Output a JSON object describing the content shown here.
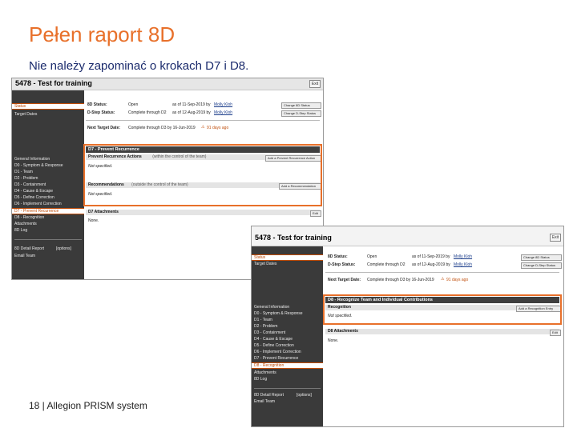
{
  "slide": {
    "title": "Pełen raport 8D",
    "subtitle": "Nie należy zapominać o krokach D7 i D8.",
    "footer": "18 | Allegion PRISM system"
  },
  "colors": {
    "accent": "#e8702a",
    "subtitle": "#1a2a6c",
    "sidebar": "#3a3a3a"
  },
  "shot1": {
    "title": "5478 - Test for training",
    "exit": "Exit",
    "sidebar": {
      "status": "Status",
      "target_dates": "Target Dates",
      "items": [
        "General Information",
        "D0 - Symptom & Response",
        "D1 - Team",
        "D2 - Problem",
        "D3 - Containment",
        "D4 - Cause & Escape",
        "D5 - Define Correction",
        "D6 - Implement Correction",
        "D7 - Prevent Recurrence",
        "D8 - Recognition",
        "Attachments",
        "8D Log"
      ],
      "highlighted_index": 8,
      "report": "8D Detail Report",
      "options": "[options]",
      "email": "Email Team"
    },
    "status": {
      "label_8d": "8D Status:",
      "value_8d": "Open",
      "asof_8d": "as of 11-Sep-2019 by",
      "user_8d": "Molly Kloh",
      "btn_8d": "Change 8D Status",
      "label_dstep": "D-Step Status:",
      "value_dstep": "Complete through D2",
      "asof_dstep": "as of 12-Aug-2019 by",
      "user_dstep": "Molly Kloh",
      "btn_dstep": "Change D-Step Status",
      "label_next": "Next Target Date:",
      "value_next": "Complete through D3 by 16-Jun-2019",
      "overdue": "91 days ago"
    },
    "d7": {
      "header": "D7 - Prevent Recurrence",
      "actions_label": "Prevent Recurrence Actions",
      "actions_note": "(within the control of the team)",
      "actions_btn": "Add a Prevent Recurrence Action",
      "not_specified": "Not specified.",
      "recs_label": "Recommendations",
      "recs_note": "(outside the control of the team)",
      "recs_btn": "Add a Recommendation"
    },
    "attach": {
      "label": "D7 Attachments",
      "edit": "Edit",
      "value": "None."
    }
  },
  "shot2": {
    "title": "5478 - Test for training",
    "exit": "Exit",
    "sidebar": {
      "status": "Status",
      "target_dates": "Target Dates",
      "items": [
        "General Information",
        "D0 - Symptom & Response",
        "D1 - Team",
        "D2 - Problem",
        "D3 - Containment",
        "D4 - Cause & Escape",
        "D5 - Define Correction",
        "D6 - Implement Correction",
        "D7 - Prevent Recurrence",
        "D8 - Recognition",
        "Attachments",
        "8D Log"
      ],
      "highlighted_index": 9,
      "report": "8D Detail Report",
      "options": "[options]",
      "email": "Email Team"
    },
    "status": {
      "label_8d": "8D Status:",
      "value_8d": "Open",
      "asof_8d": "as of 11-Sep-2019 by",
      "user_8d": "Molly Kloh",
      "btn_8d": "Change 8D Status",
      "label_dstep": "D-Step Status:",
      "value_dstep": "Complete through D2",
      "asof_dstep": "as of 12-Aug-2019 by",
      "user_dstep": "Molly Kloh",
      "btn_dstep": "Change D-Step Status",
      "label_next": "Next Target Date:",
      "value_next": "Complete through D3 by 16-Jun-2019",
      "overdue": "91 days ago"
    },
    "d8": {
      "header": "D8 - Recognize Team and Individual Contributions",
      "rec_label": "Recognition",
      "rec_btn": "Add a Recognition Entry",
      "not_specified": "Not specified."
    },
    "attach": {
      "label": "D8 Attachments",
      "edit": "Edit",
      "value": "None."
    }
  }
}
